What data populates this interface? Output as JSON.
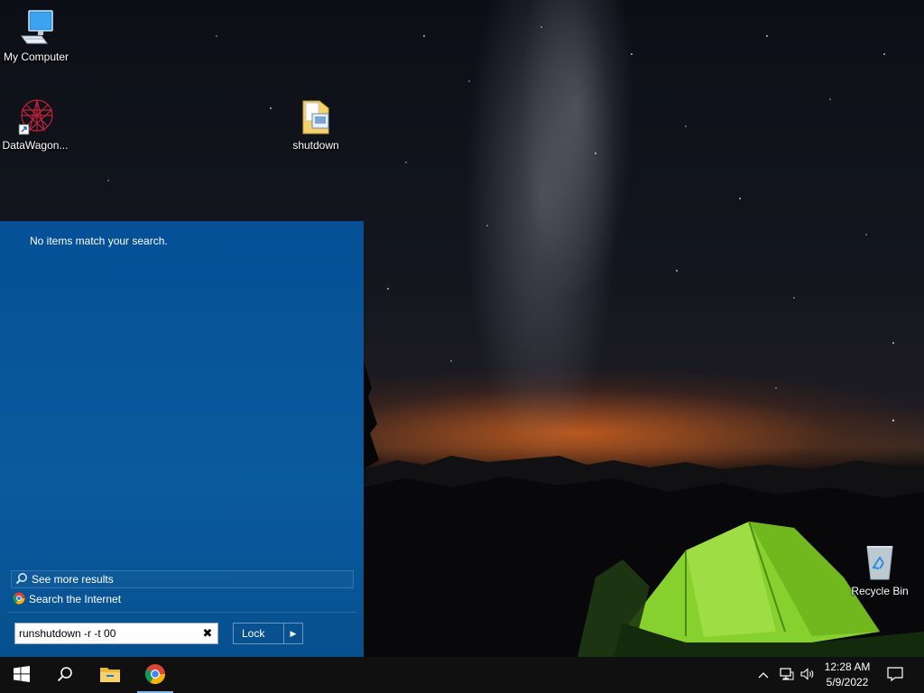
{
  "desktop": {
    "icons": [
      {
        "label": "My Computer"
      },
      {
        "label": "DataWagon..."
      },
      {
        "label": "shutdown"
      },
      {
        "label": "Recycle Bin"
      }
    ]
  },
  "start_panel": {
    "no_items_text": "No items match your search.",
    "see_more_label": "See more results",
    "search_internet_label": "Search the Internet",
    "search_value": "runshutdown -r -t 00",
    "power_button_label": "Lock"
  },
  "taskbar": {
    "buttons": [
      "windows-start",
      "search",
      "file-explorer",
      "chrome"
    ],
    "clock_time": "12:28 AM",
    "clock_date": "5/9/2022"
  },
  "colors": {
    "panel": "#055096",
    "taskbar": "#101010",
    "accent": "#7fb2e8"
  }
}
